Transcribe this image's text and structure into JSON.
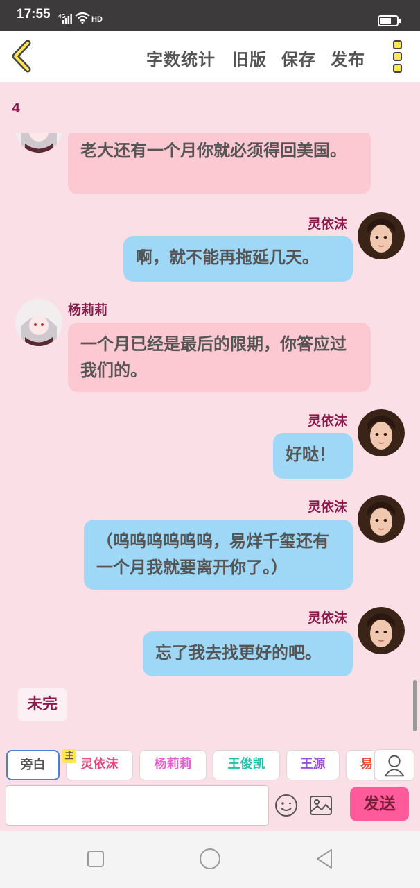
{
  "status_bar": {
    "time": "17:55",
    "network": "4G",
    "hd": "HD"
  },
  "header": {
    "actions": {
      "word_count": "字数统计",
      "old_version": "旧版",
      "save": "保存",
      "publish": "发布"
    }
  },
  "chat": {
    "chapter_number": "4",
    "messages": [
      {
        "speaker": "",
        "text": "老大还有一个月你就必须得回美国。",
        "side": "left"
      },
      {
        "speaker": "灵依沫",
        "text": "啊，就不能再拖延几天。",
        "side": "right"
      },
      {
        "speaker": "杨莉莉",
        "text": "一个月已经是最后的限期，你答应过我们的。",
        "side": "left"
      },
      {
        "speaker": "灵依沫",
        "text": "好哒！",
        "side": "right"
      },
      {
        "speaker": "灵依沫",
        "text": "（呜呜呜呜呜呜，易烊千玺还有一个月我就要离开你了。）",
        "side": "right"
      },
      {
        "speaker": "灵依沫",
        "text": "忘了我去找更好的吧。",
        "side": "right"
      }
    ],
    "unfinished_label": "未完"
  },
  "input_area": {
    "characters": [
      {
        "name": "旁白",
        "color": "#555555"
      },
      {
        "name": "灵依沫",
        "color": "#e9457a"
      },
      {
        "name": "杨莉莉",
        "color": "#e95fd0"
      },
      {
        "name": "王俊凯",
        "color": "#1fbfa8"
      },
      {
        "name": "王源",
        "color": "#9a4fe0"
      },
      {
        "name": "易",
        "color": "#e84a2f"
      }
    ],
    "main_badge": "主",
    "placeholder": "",
    "send_label": "发送"
  },
  "icons": {
    "back": "chevron-left-icon",
    "more": "more-vertical-icon",
    "person": "person-icon",
    "emoji": "emoji-icon",
    "image": "image-icon",
    "nav_recent": "square-icon",
    "nav_home": "circle-icon",
    "nav_back": "triangle-left-icon"
  },
  "colors": {
    "background": "#fae0e6",
    "pink_bubble": "#fcc8d2",
    "blue_bubble": "#9fd8f7",
    "name_color": "#8a1a4a",
    "send_button": "#ff5a99"
  }
}
